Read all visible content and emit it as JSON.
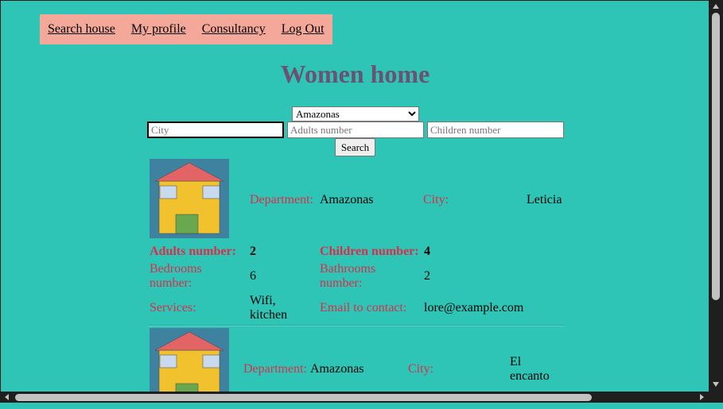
{
  "nav": {
    "items": [
      {
        "label": "Search house"
      },
      {
        "label": "My profile"
      },
      {
        "label": "Consultancy"
      },
      {
        "label": "Log Out"
      }
    ]
  },
  "page": {
    "title": "Women home"
  },
  "filters": {
    "department_selected": "Amazonas",
    "city_placeholder": "City",
    "adults_placeholder": "Adults number",
    "children_placeholder": "Children number",
    "search_label": "Search"
  },
  "labels": {
    "department": "Department:",
    "city": "City:",
    "adults": "Adults number:",
    "children": "Children number:",
    "bedrooms": "Bedrooms number:",
    "bathrooms": "Bathrooms number:",
    "services": "Services:",
    "email": "Email to contact:"
  },
  "listings": [
    {
      "department": "Amazonas",
      "city": "Leticia",
      "adults": "2",
      "children": "4",
      "bedrooms": "6",
      "bathrooms": "2",
      "services": "Wifi, kitchen",
      "email": "lore@example.com"
    },
    {
      "department": "Amazonas",
      "city": "El encanto"
    }
  ],
  "colors": {
    "background": "#2ec4b6",
    "nav_bg": "#f4a89a",
    "title": "#6a5273",
    "label": "#d9304a",
    "house_bg": "#3f82a0",
    "roof": "#e36464",
    "walls": "#f2c12e",
    "door": "#6aa84f",
    "window": "#c9d9ee"
  }
}
